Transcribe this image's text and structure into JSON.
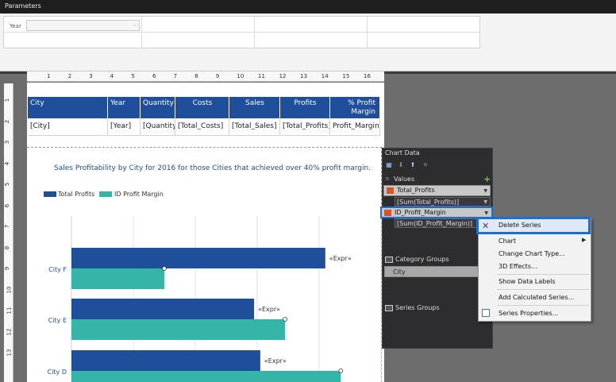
{
  "params": {
    "header": "Parameters",
    "year_label": "Year",
    "year_value": ""
  },
  "ruler": {
    "h_ticks": [
      "1",
      "2",
      "3",
      "4",
      "5",
      "6",
      "7",
      "8",
      "9",
      "10",
      "11",
      "12",
      "13",
      "14",
      "15",
      "16"
    ],
    "v_ticks": [
      "1",
      "2",
      "3",
      "4",
      "5",
      "6",
      "7",
      "8",
      "9",
      "10",
      "11",
      "12",
      "13"
    ]
  },
  "table": {
    "headers": [
      "City",
      "Year",
      "Quantity",
      "Costs",
      "Sales",
      "Profits",
      "% Profit Margin"
    ],
    "cells": [
      "[City]",
      "[Year]",
      "[Quantity]",
      "[Total_Costs]",
      "[Total_Sales]",
      "[Total_Profits]",
      "Profit_Margin]"
    ]
  },
  "chart": {
    "title": "Sales Profitability by City for 2016 for those Cities that achieved over 40% profit margin.",
    "expr_label": "«Expr»",
    "colors": {
      "profits": "#1f4e9a",
      "margin": "#35b5a7"
    }
  },
  "chart_data": {
    "type": "bar",
    "orientation": "horizontal",
    "categories": [
      "City F",
      "City E",
      "City D"
    ],
    "series": [
      {
        "name": "Total Profits",
        "values": [
          0.82,
          0.59,
          0.61
        ]
      },
      {
        "name": "ID Profit Margin",
        "values": [
          0.3,
          0.69,
          0.87
        ]
      }
    ],
    "xlim": [
      0,
      1
    ],
    "grid": true,
    "legend": "top-left"
  },
  "chart_data_panel": {
    "title": "Chart Data",
    "values_label": "Values",
    "values": [
      {
        "label": "Total_Profits",
        "expr": "[Sum(Total_Profits)]"
      },
      {
        "label": "ID_Profit_Margin",
        "expr": "[Sum(ID_Profit_Margin)]"
      }
    ],
    "category_groups_label": "Category Groups",
    "category_groups": [
      "City"
    ],
    "series_groups_label": "Series Groups"
  },
  "context_menu": {
    "items": [
      "Delete Series",
      "Chart",
      "Change Chart Type...",
      "3D Effects...",
      "Show Data Labels",
      "Add Calculated Series...",
      "Series Properties..."
    ]
  },
  "icons": {
    "delete": "close-icon",
    "properties": "properties-icon",
    "submenu": "chevron-right-icon"
  }
}
